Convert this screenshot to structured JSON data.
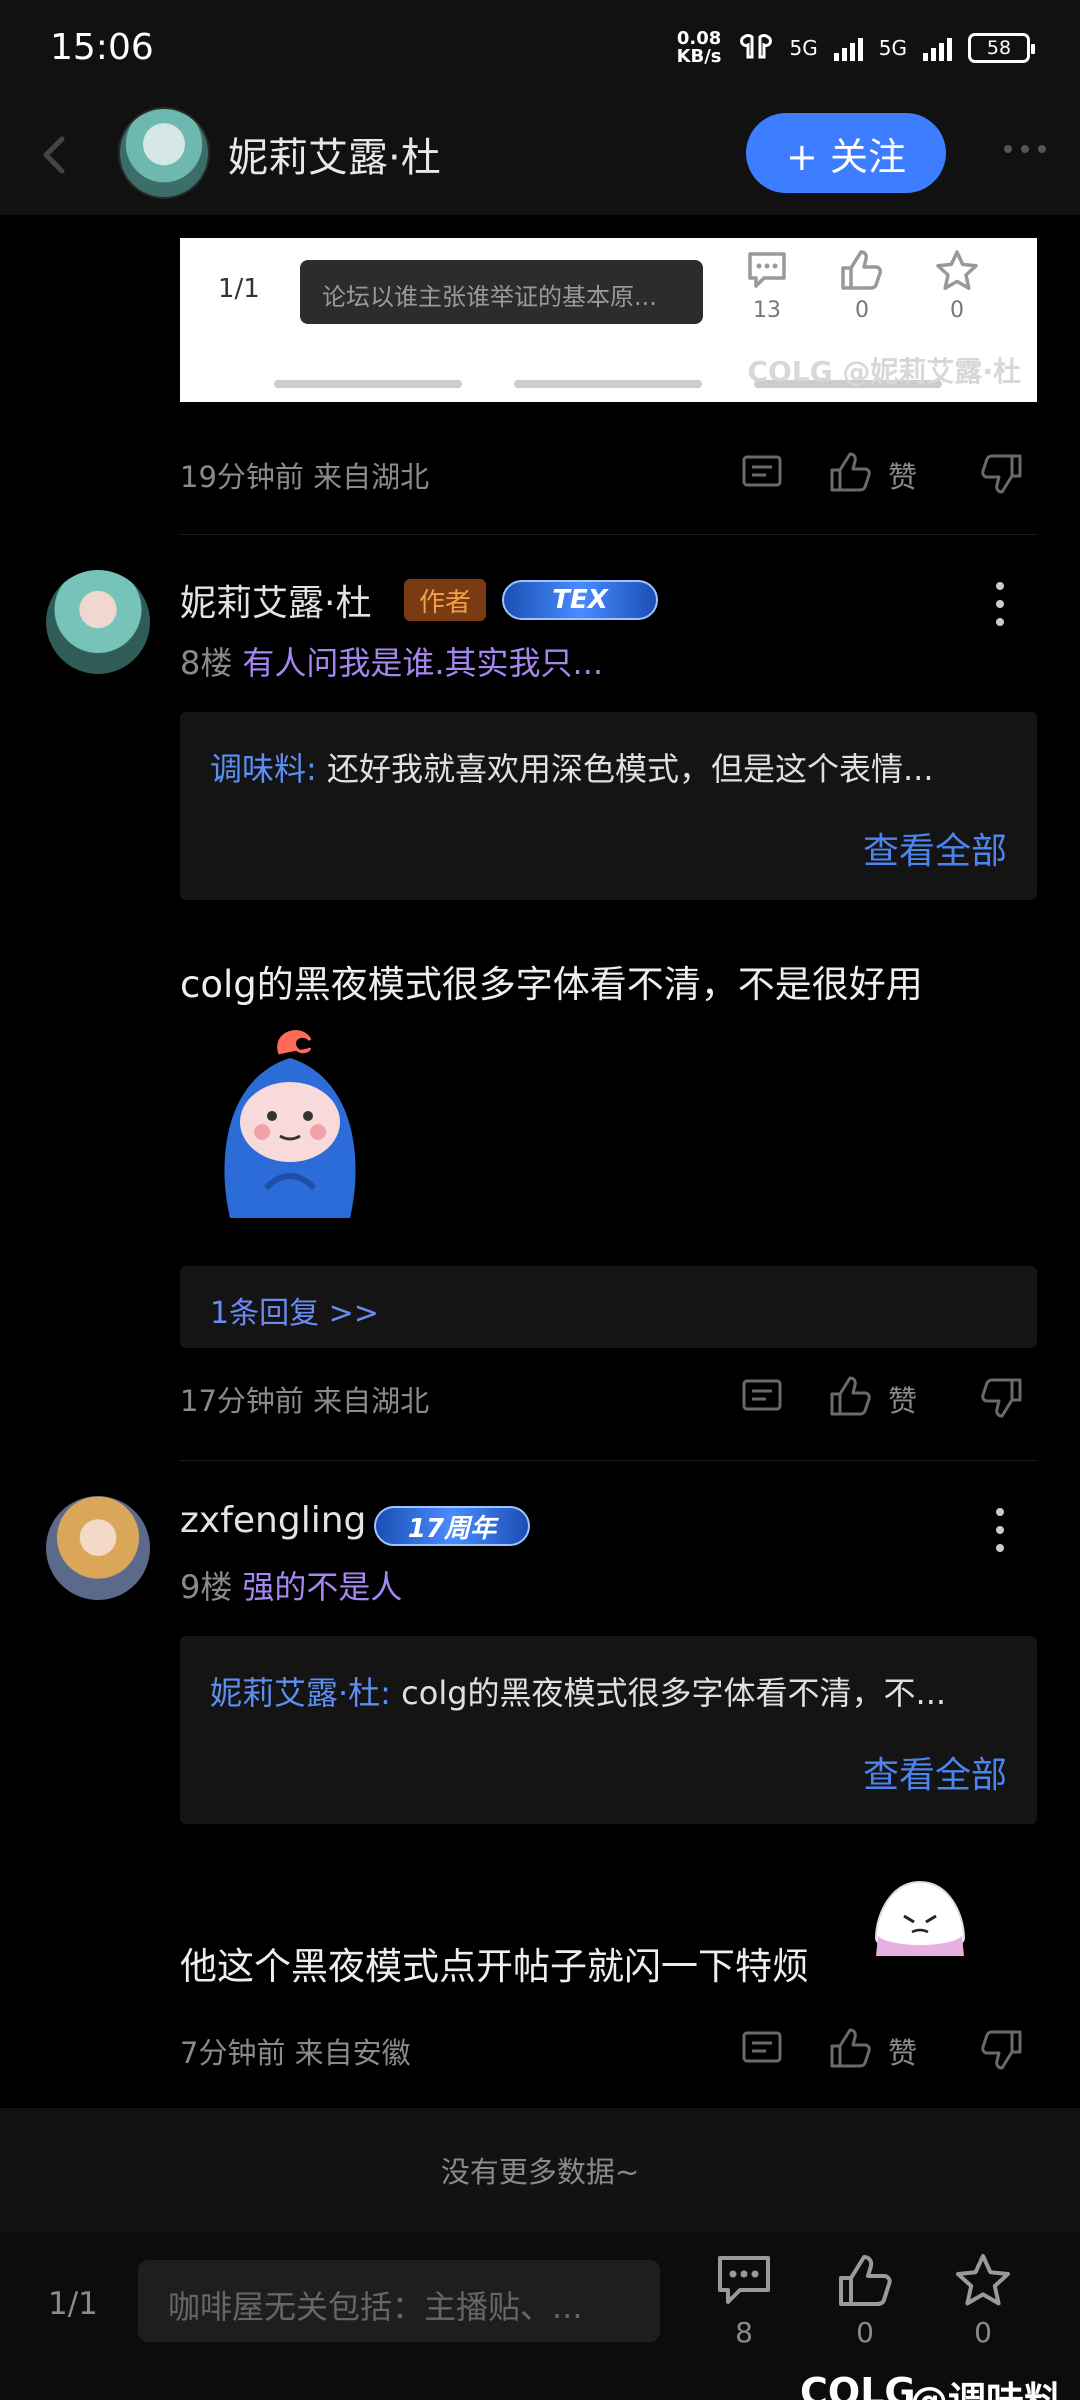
{
  "status_bar": {
    "time": "15:06",
    "net_speed_value": "0.08",
    "net_speed_unit": "KB/s",
    "sim1": "5G",
    "sim2": "5G",
    "battery": "58"
  },
  "header": {
    "name": "妮莉艾露·杜",
    "follow_label": "+ 关注"
  },
  "embedded_shot": {
    "page_indicator": "1/1",
    "input_placeholder": "论坛以谁主张谁举证的基本原...",
    "comment_count": "13",
    "like_count": "0",
    "fav_count": "0",
    "watermark": "COLG @妮莉艾露·杜"
  },
  "post_meta_1": {
    "time": "19分钟前",
    "location": "来自湖北",
    "like_label": "赞"
  },
  "comment_8": {
    "author": "妮莉艾露·杜",
    "author_badge": "作者",
    "level_badge": "TEX",
    "floor": "8楼",
    "ref_text": "有人问我是谁.其实我只...",
    "quote_name": "调味料:",
    "quote_text": "还好我就喜欢用深色模式，但是这个表情...",
    "view_all": "查看全部",
    "body": "colg的黑夜模式很多字体看不清，不是很好用",
    "reply_link": "1条回复 >>",
    "time": "17分钟前",
    "location": "来自湖北",
    "like_label": "赞"
  },
  "comment_9": {
    "author": "zxfengling",
    "level_badge": "17周年",
    "floor": "9楼",
    "ref_text": "强的不是人",
    "quote_name": "妮莉艾露·杜:",
    "quote_text": "colg的黑夜模式很多字体看不清，不...",
    "view_all": "查看全部",
    "body": "他这个黑夜模式点开帖子就闪一下特烦",
    "time": "7分钟前",
    "location": "来自安徽",
    "like_label": "赞"
  },
  "no_more": "没有更多数据~",
  "bottom_bar": {
    "page_indicator": "1/1",
    "input_placeholder": "咖啡屋无关包括：主播贴、...",
    "comment_count": "8",
    "like_count": "0",
    "fav_count": "0"
  },
  "watermark": {
    "brand": "COLG",
    "handle": "@调味料"
  },
  "colors": {
    "accent": "#3d7dff",
    "quote_name": "#5d8ff2",
    "ref": "#a487f0",
    "author_badge": "#7a3a12"
  }
}
